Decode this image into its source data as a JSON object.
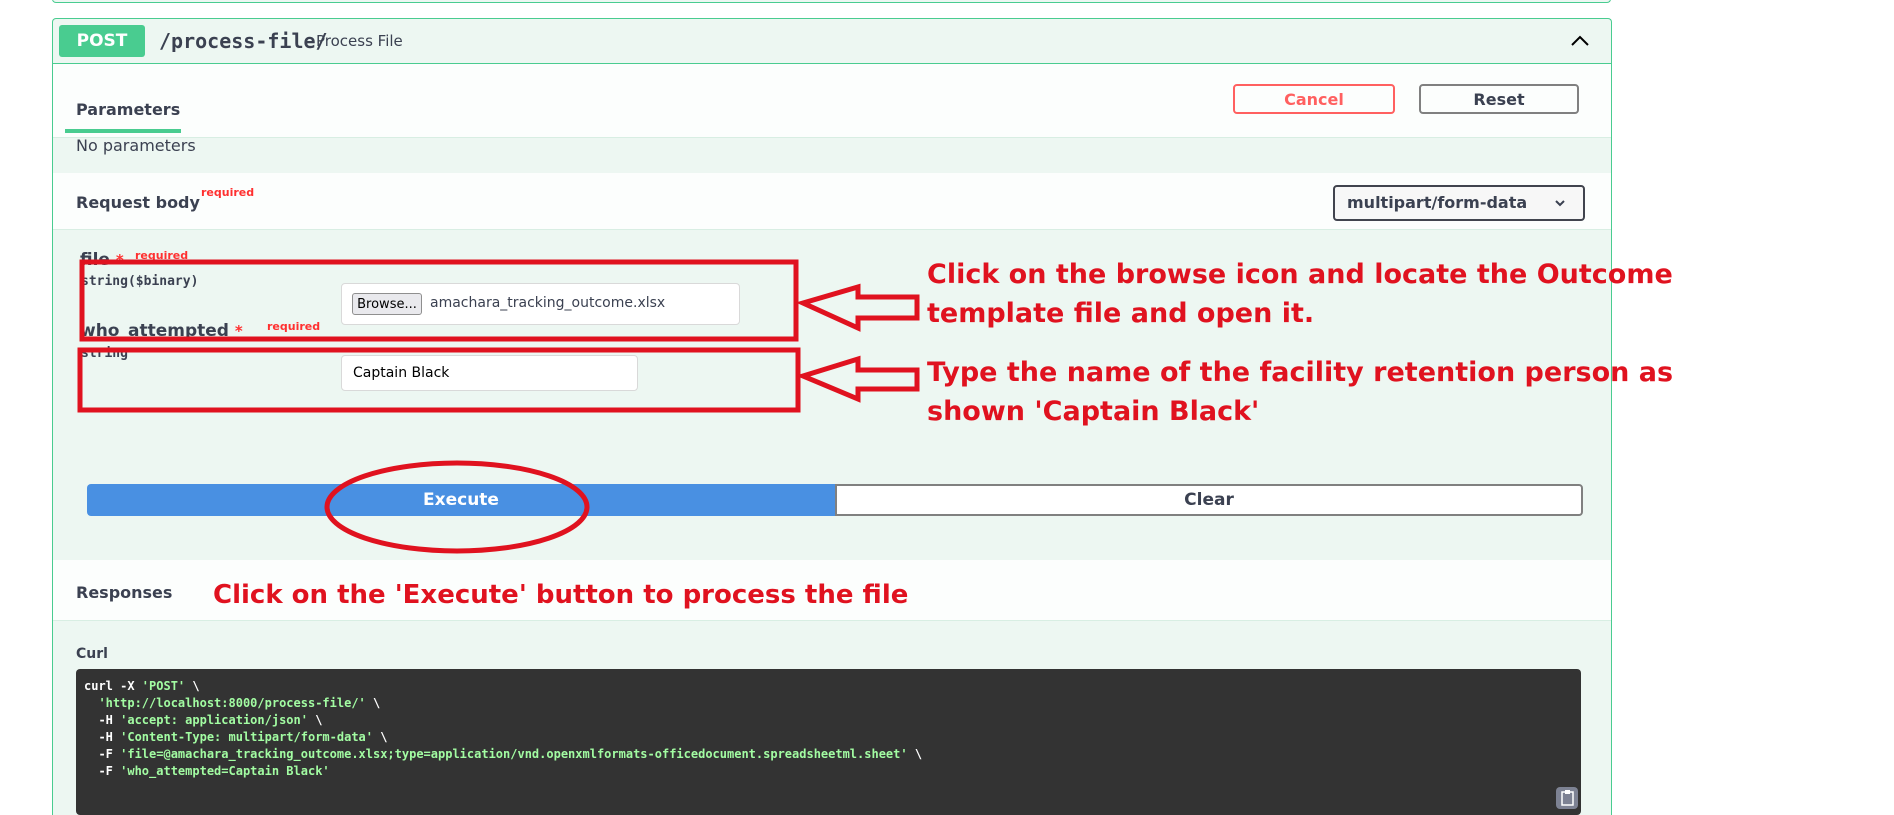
{
  "operation": {
    "method": "POST",
    "path": "/process-file/",
    "summary": "Process File"
  },
  "parameters": {
    "tab_label": "Parameters",
    "cancel_label": "Cancel",
    "reset_label": "Reset",
    "empty_text": "No parameters"
  },
  "request_body": {
    "title": "Request body",
    "required_text": "required",
    "content_type": "multipart/form-data",
    "fields": [
      {
        "name": "file",
        "star": "*",
        "required": "required",
        "type": "string($binary)",
        "browse_label": "Browse...",
        "file_name": "amachara_tracking_outcome.xlsx"
      },
      {
        "name": "who_attempted",
        "star": "*",
        "required": "required",
        "type": "string",
        "value": "Captain Black"
      }
    ]
  },
  "actions": {
    "execute_label": "Execute",
    "clear_label": "Clear"
  },
  "responses": {
    "title": "Responses",
    "curl_label": "Curl",
    "curl_lines": [
      {
        "plain": "curl -X ",
        "str": "'POST'",
        "tail": " \\"
      },
      {
        "plain": "  ",
        "str": "'http://localhost:8000/process-file/'",
        "tail": " \\"
      },
      {
        "plain": "  -H ",
        "str": "'accept: application/json'",
        "tail": " \\"
      },
      {
        "plain": "  -H ",
        "str": "'Content-Type: multipart/form-data'",
        "tail": " \\"
      },
      {
        "plain": "  -F ",
        "str": "'file=@amachara_tracking_outcome.xlsx;type=application/vnd.openxmlformats-officedocument.spreadsheetml.sheet'",
        "tail": " \\"
      },
      {
        "plain": "  -F ",
        "str": "'who_attempted=Captain Black'",
        "tail": ""
      }
    ]
  },
  "annotations": {
    "browse_note_1": "Click on the browse icon and locate the Outcome",
    "browse_note_2": "template file and open it.",
    "name_note_1": "Type the name of the facility retention person as",
    "name_note_2": "shown 'Captain Black'",
    "execute_note": "Click on the 'Execute' button to process the file"
  },
  "colors": {
    "post_green": "#49cc90",
    "execute_blue": "#4990e2",
    "annotation_red": "#e0121f",
    "cancel_red": "#ff6060"
  }
}
